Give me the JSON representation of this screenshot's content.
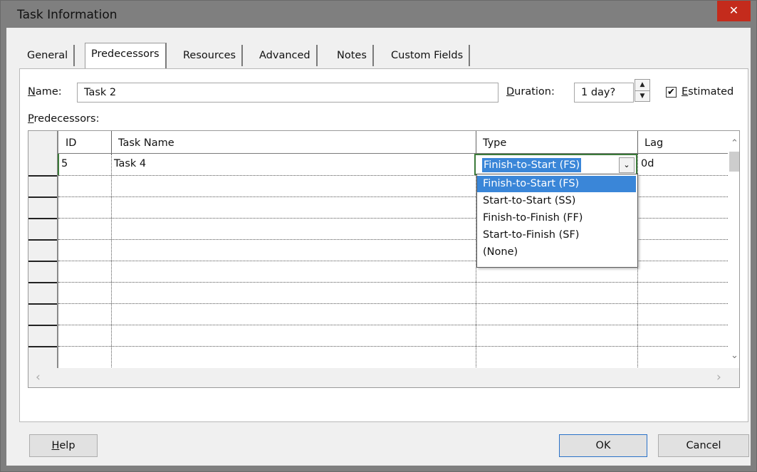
{
  "window": {
    "title": "Task Information",
    "close_glyph": "✕"
  },
  "tabs": [
    {
      "label": "General"
    },
    {
      "label": "Predecessors"
    },
    {
      "label": "Resources"
    },
    {
      "label": "Advanced"
    },
    {
      "label": "Notes"
    },
    {
      "label": "Custom Fields"
    }
  ],
  "active_tab": "Predecessors",
  "form": {
    "name_label_u": "N",
    "name_label_rest": "ame:",
    "name_value": "Task 2",
    "duration_label_u": "D",
    "duration_label_rest": "uration:",
    "duration_value": "1 day?",
    "estimated_label_u": "E",
    "estimated_label_rest": "stimated",
    "estimated_checked": "✔",
    "predecessors_label_u": "P",
    "predecessors_label_rest": "redecessors:"
  },
  "grid": {
    "columns": [
      "ID",
      "Task Name",
      "Type",
      "Lag"
    ],
    "rows": [
      {
        "id": "5",
        "task_name": "Task 4",
        "type": "Finish-to-Start (FS)",
        "lag": "0d"
      }
    ]
  },
  "type_dropdown": {
    "options": [
      "Finish-to-Start (FS)",
      "Start-to-Start (SS)",
      "Finish-to-Finish (FF)",
      "Start-to-Finish (SF)",
      "(None)"
    ],
    "selected": "Finish-to-Start (FS)"
  },
  "buttons": {
    "help_u": "H",
    "help_rest": "elp",
    "ok": "OK",
    "cancel": "Cancel"
  },
  "icons": {
    "spin_up": "▲",
    "spin_down": "▼",
    "combo_arrow": "⌄",
    "scroll_up": "⌃",
    "scroll_down": "⌄",
    "scroll_left": "‹",
    "scroll_right": "›"
  }
}
